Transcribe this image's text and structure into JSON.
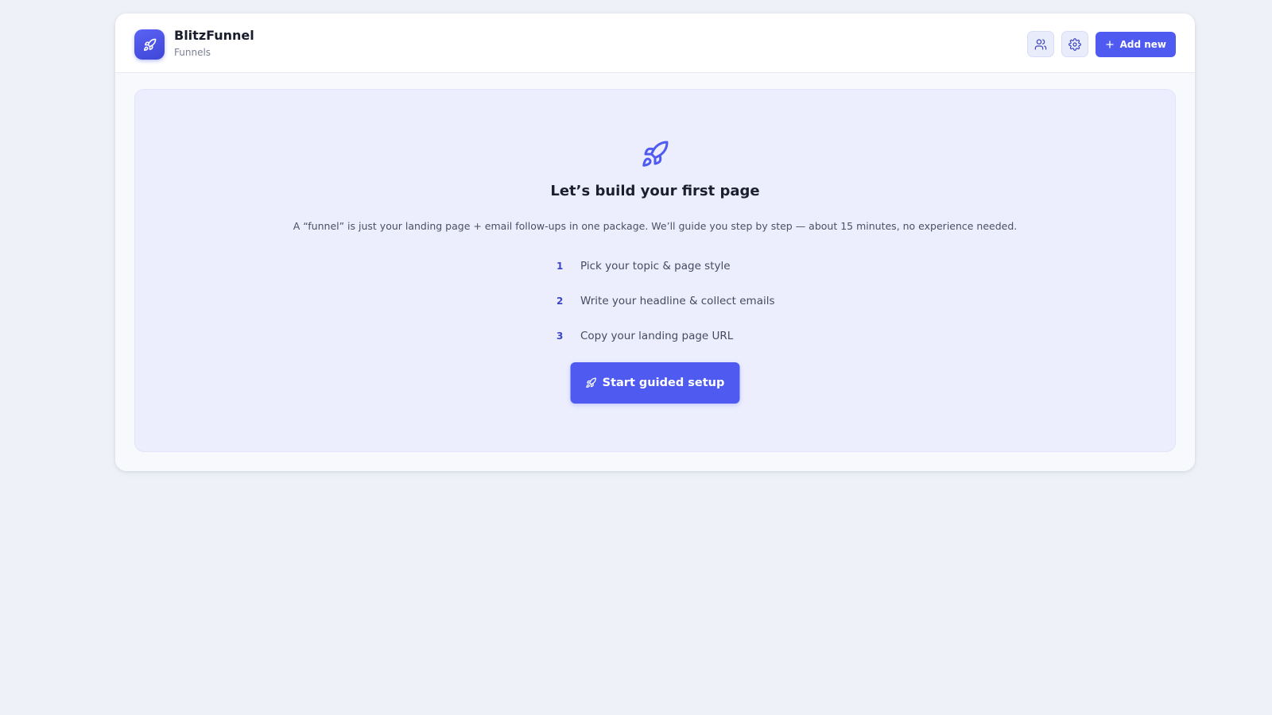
{
  "brand": {
    "name": "BlitzFunnel",
    "subtitle": "Funnels"
  },
  "header": {
    "add_label": "Add new"
  },
  "hero": {
    "title": "Let’s build your first page",
    "description": "A “funnel” is just your landing page + email follow-ups in one package. We’ll guide you step by step — about 15 minutes, no experience needed.",
    "steps": [
      {
        "num": "1",
        "text": "Pick your topic & page style"
      },
      {
        "num": "2",
        "text": "Write your headline & collect emails"
      },
      {
        "num": "3",
        "text": "Copy your landing page URL"
      }
    ],
    "cta_label": "Start guided setup"
  },
  "icons": {
    "logo": "rocket-icon",
    "team": "users-icon",
    "settings": "gear-icon",
    "add": "plus-icon",
    "hero": "rocket-icon",
    "cta": "rocket-icon"
  },
  "colors": {
    "accent": "#4f5bf0",
    "panel": "#eceefe",
    "background": "#eef1f8"
  }
}
